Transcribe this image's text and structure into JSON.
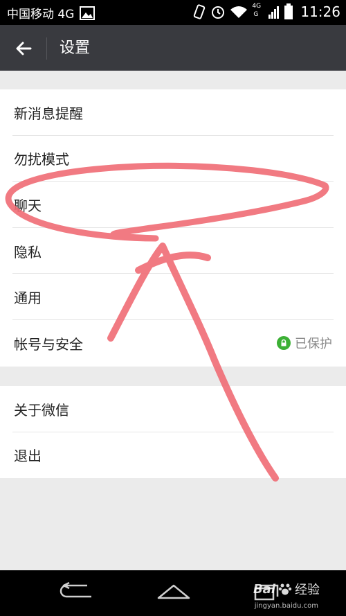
{
  "status_bar": {
    "carrier": "中国移动 4G",
    "network_badge_top": "4G",
    "network_badge_bottom": "G",
    "time": "11:26"
  },
  "app_bar": {
    "title": "设置"
  },
  "settings": {
    "group1": [
      {
        "label": "新消息提醒"
      },
      {
        "label": "勿扰模式"
      },
      {
        "label": "聊天"
      },
      {
        "label": "隐私"
      },
      {
        "label": "通用"
      },
      {
        "label": "帐号与安全",
        "status": "已保护"
      }
    ],
    "group2": [
      {
        "label": "关于微信"
      },
      {
        "label": "退出"
      }
    ]
  },
  "watermark": {
    "brand": "Bai",
    "brand_suffix": "经验",
    "url": "jingyan.baidu.com"
  },
  "colors": {
    "app_bar": "#393a3f",
    "accent_green": "#3cb035",
    "annotation_red": "#f06c74"
  }
}
